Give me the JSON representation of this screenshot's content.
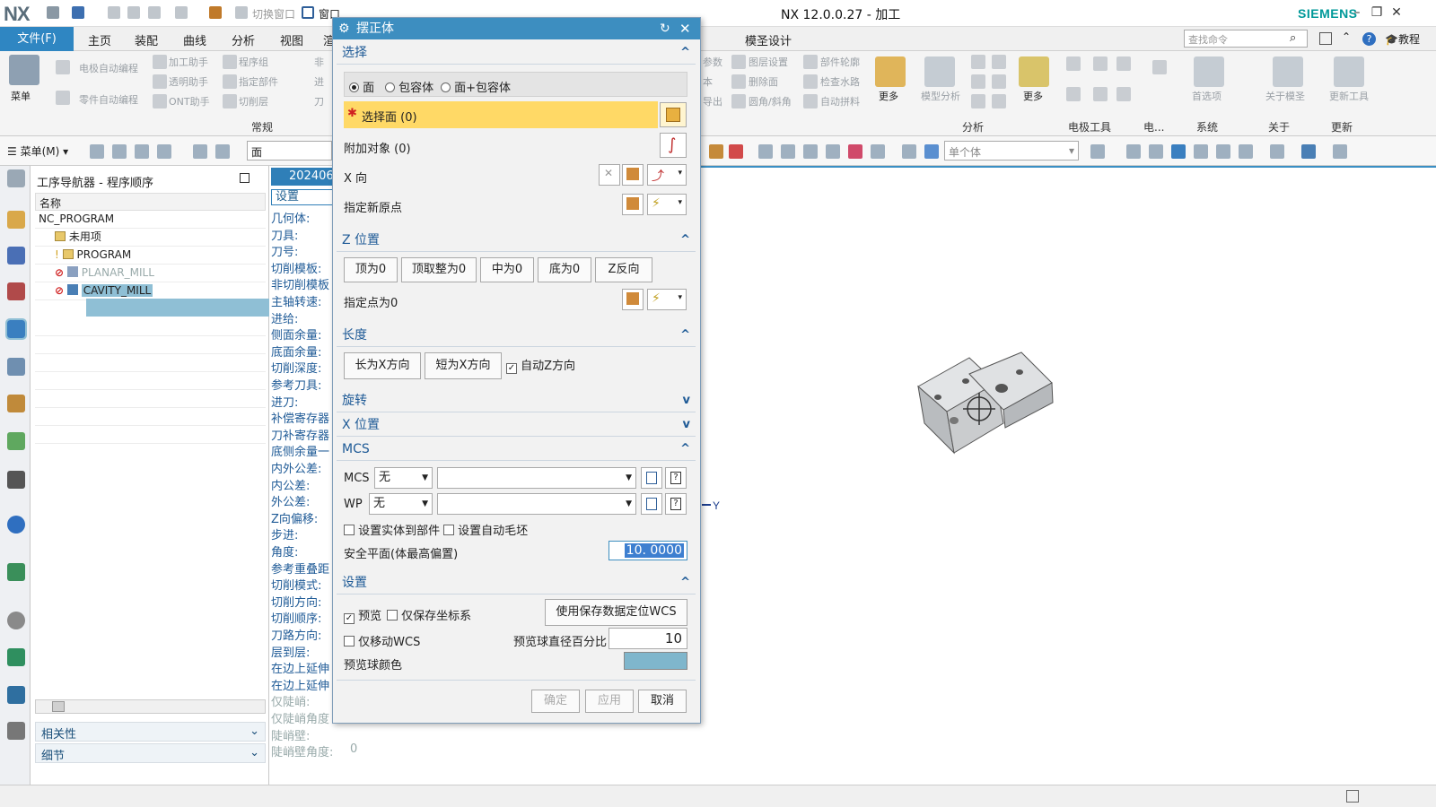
{
  "app": {
    "logo": "NX",
    "title": "NX 12.0.0.27 - 加工",
    "brand": "SIEMENS"
  },
  "quick_access": {
    "switch_window": "切换窗口",
    "window": "窗口"
  },
  "menubar": {
    "file": "文件(F)",
    "tabs": [
      "主页",
      "装配",
      "曲线",
      "分析",
      "视图",
      "渲"
    ],
    "right_tab": "模圣设计",
    "search_placeholder": "查找命令",
    "tutorial": "教程"
  },
  "ribbon": {
    "menu_label": "菜单",
    "left_items": [
      "电极自动编程",
      "加工助手",
      "程序组",
      "非",
      "零件自动编程",
      "透明助手",
      "指定部件",
      "进",
      "ONT助手",
      "切削层",
      "刀"
    ],
    "group_common": "常规",
    "more1": "更多",
    "mid_items": [
      "参数",
      "图层设置",
      "部件轮廓",
      "本",
      "删除面",
      "检查水路",
      "导出",
      "圆角/斜角",
      "自动拼料"
    ],
    "model_analysis": "模型分析",
    "more2": "更多",
    "group_analysis": "分析",
    "group_electrode": "电极工具",
    "group_e": "电...",
    "group_system": "系统",
    "preferences": "首选项",
    "about_label": "关于模圣",
    "group_about": "关于",
    "update_label": "更新工具",
    "group_update": "更新"
  },
  "toolrow": {
    "menu": "菜单(M)",
    "filter": "面",
    "single_body": "单个体"
  },
  "navigator": {
    "title": "工序导航器 - 程序顺序",
    "col_name": "名称",
    "rows": [
      "NC_PROGRAM",
      "未用项",
      "PROGRAM",
      "PLANAR_MILL",
      "CAVITY_MILL"
    ],
    "relations": "相关性",
    "details": "细节"
  },
  "op_panel": {
    "tab": "202406",
    "subtab": "设置",
    "labels": [
      "几何体:",
      "刀具:",
      "刀号:",
      "切削模板:",
      "非切削模板",
      "主轴转速:",
      "进给:",
      "侧面余量:",
      "底面余量:",
      "切削深度:",
      "参考刀具:",
      "进刀:",
      "补偿寄存器",
      "刀补寄存器",
      "底侧余量一",
      "内外公差:",
      "内公差:",
      "外公差:",
      "Z向偏移:",
      "步进:",
      "角度:",
      "参考重叠距",
      "切削模式:",
      "切削方向:",
      "切削顺序:",
      "刀路方向:",
      "层到层:",
      "在边上延伸",
      "在边上延伸",
      "仅陡峭:",
      "仅陡峭角度",
      "陡峭壁:",
      "陡峭壁角度:"
    ],
    "steep_wall_angle_value": "0"
  },
  "dialog": {
    "title": "摆正体",
    "select_section": "选择",
    "radio_options": [
      "面",
      "包容体",
      "面+包容体"
    ],
    "select_face": "选择面 (0)",
    "attach_object": "附加对象 (0)",
    "x_dir": "X 向",
    "new_origin": "指定新原点",
    "z_section": "Z 位置",
    "z_buttons": [
      "顶为0",
      "顶取整为0",
      "中为0",
      "底为0",
      "Z反向"
    ],
    "z_point": "指定点为0",
    "length_section": "长度",
    "length_buttons": [
      "长为X方向",
      "短为X方向"
    ],
    "auto_z": "自动Z方向",
    "rotate_section": "旋转",
    "x_pos_section": "X 位置",
    "mcs_section": "MCS",
    "mcs_label": "MCS",
    "mcs_value": "无",
    "wp_label": "WP",
    "wp_value": "无",
    "set_solid": "设置实体到部件",
    "auto_blank": "设置自动毛坯",
    "safe_plane_label": "安全平面(体最高偏置)",
    "safe_plane_value": "10. 0000",
    "settings_section": "设置",
    "preview": "预览",
    "save_csys_only": "仅保存坐标系",
    "use_saved_wcs": "使用保存数据定位WCS",
    "move_wcs_only": "仅移动WCS",
    "ball_pct_label": "预览球直径百分比",
    "ball_pct_value": "10",
    "ball_color_label": "预览球颜色",
    "ball_color": "#7fb6cc",
    "ok": "确定",
    "apply": "应用",
    "cancel": "取消"
  },
  "graphics": {
    "axis_label": "Y"
  },
  "colors": {
    "accent": "#2f86c2",
    "dialog_title": "#3d8ec0",
    "highlight": "#ffd966",
    "selected_row": "#8fbfd5"
  }
}
